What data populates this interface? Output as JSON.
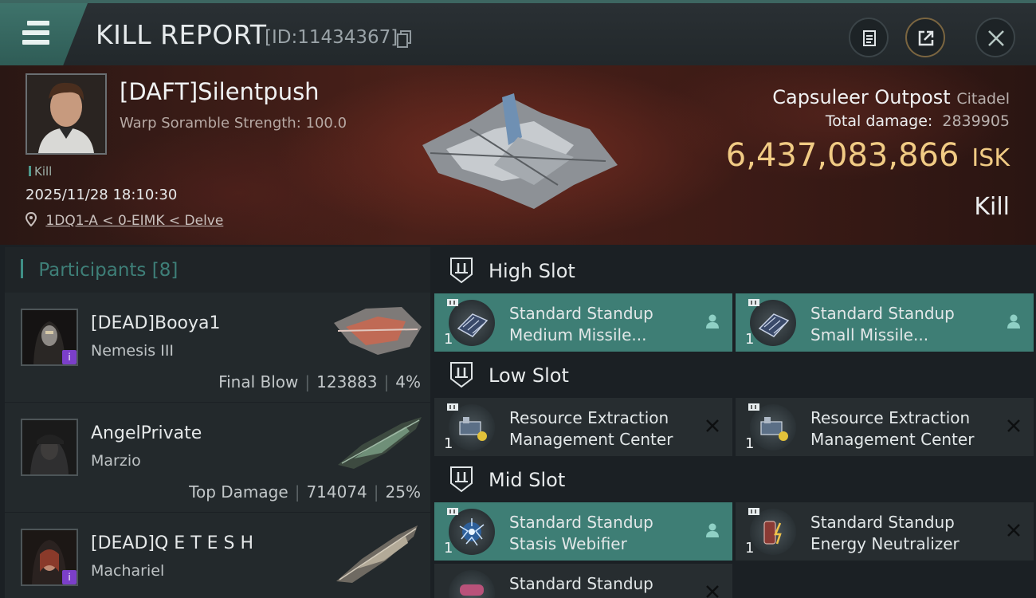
{
  "header": {
    "title": "KILL REPORT",
    "report_id": "[ID:11434367]",
    "icons": {
      "menu": "menu-icon",
      "copy": "copy-icon",
      "clipboard": "clipboard-icon",
      "share": "share-icon",
      "close": "close-icon"
    }
  },
  "victim": {
    "name": "[DAFT]Silentpush",
    "scramble": "Warp Soramble Strength: 100.0",
    "kill_tag": "Kill",
    "datetime": "2025/11/28 18:10:30",
    "location": "1DQ1-A < 0-EIMK < Delve",
    "target_name": "Capsuleer Outpost",
    "target_class": "Citadel",
    "total_damage_label": "Total damage:",
    "total_damage": "2839905",
    "isk_value": "6,437,083,866",
    "isk_unit": "ISK",
    "result": "Kill"
  },
  "participants": {
    "label": "Participants",
    "count": "[8]",
    "items": [
      {
        "name": "[DEAD]Booya1",
        "ship": "Nemesis III",
        "stat_label": "Final Blow",
        "damage": "123883",
        "percent": "4%",
        "badge": "i"
      },
      {
        "name": "AngelPrivate",
        "ship": "Marzio",
        "stat_label": "Top Damage",
        "damage": "714074",
        "percent": "25%",
        "badge": ""
      },
      {
        "name": "[DEAD]Q E T E S H",
        "ship": "Machariel",
        "stat_label": "",
        "damage": "",
        "percent": "",
        "badge": "i"
      }
    ]
  },
  "slots": {
    "high": {
      "title": "High Slot",
      "modules": [
        {
          "line1": "Standard Standup",
          "line2": "Medium Missile...",
          "qty": "1",
          "state": "person-icon",
          "active": true
        },
        {
          "line1": "Standard Standup",
          "line2": "Small Missile...",
          "qty": "1",
          "state": "person-icon",
          "active": true
        }
      ]
    },
    "low": {
      "title": "Low Slot",
      "modules": [
        {
          "line1": "Resource Extraction",
          "line2": "Management Center",
          "qty": "1",
          "state": "x-icon",
          "active": false
        },
        {
          "line1": "Resource Extraction",
          "line2": "Management Center",
          "qty": "1",
          "state": "x-icon",
          "active": false
        }
      ]
    },
    "mid": {
      "title": "Mid Slot",
      "modules": [
        {
          "line1": "Standard Standup",
          "line2": "Stasis Webifier",
          "qty": "1",
          "state": "person-icon",
          "active": true
        },
        {
          "line1": "Standard Standup",
          "line2": "Energy Neutralizer",
          "qty": "1",
          "state": "x-icon",
          "active": false
        },
        {
          "line1": "Standard Standup",
          "line2": "",
          "qty": "",
          "state": "x-icon",
          "active": false
        }
      ]
    }
  },
  "colors": {
    "accent_teal": "#3e7e75",
    "isk_gold": "#f1cb84",
    "badge_purple": "#7b3fc9"
  }
}
